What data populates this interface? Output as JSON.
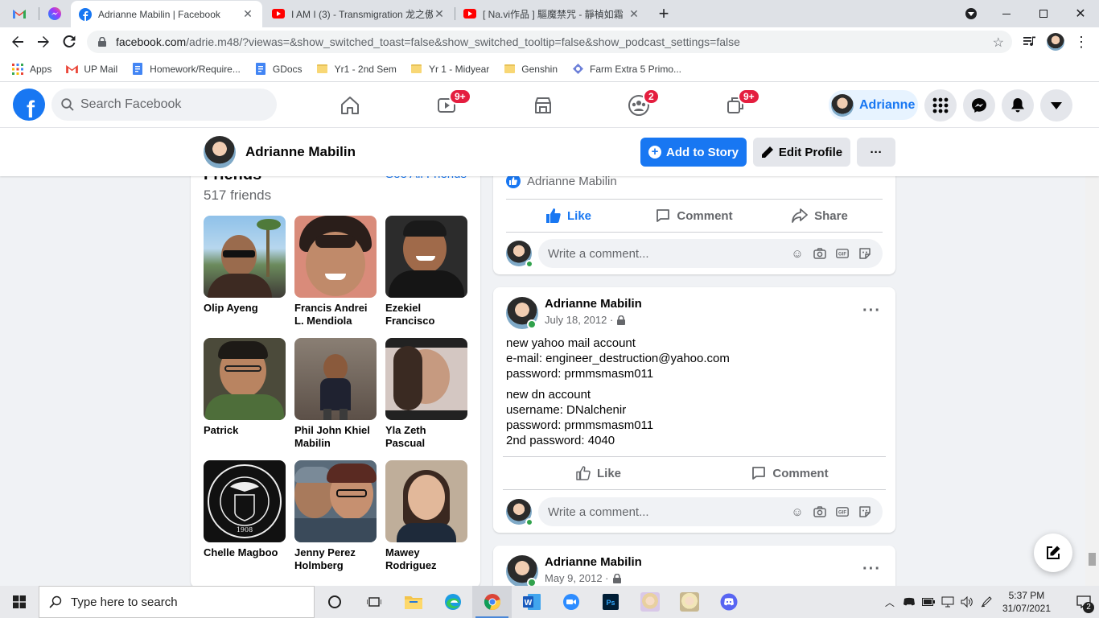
{
  "browser": {
    "tabs": [
      {
        "title": "",
        "icon": "gmail-icon"
      },
      {
        "title": "",
        "icon": "messenger-icon"
      },
      {
        "title": "Adrianne Mabilin | Facebook",
        "icon": "facebook-icon",
        "active": true
      },
      {
        "title": "I AM I (3) - Transmigration 龙之傲",
        "icon": "youtube-icon"
      },
      {
        "title": "[ Na.vi作品 ] 驅魔禁咒 - 靜楨如霜",
        "icon": "youtube-icon"
      }
    ],
    "new_tab": "+",
    "url_host": "facebook.com",
    "url_rest": "/adrie.m48/?viewas=&show_switched_toast=false&show_switched_tooltip=false&show_podcast_settings=false",
    "bookmarks": [
      "Apps",
      "UP Mail",
      "Homework/Require...",
      "GDocs",
      "Yr1 - 2nd Sem",
      "Yr 1 - Midyear",
      "Genshin",
      "Farm Extra 5 Primo..."
    ]
  },
  "fb_nav": {
    "search_placeholder": "Search Facebook",
    "watch_badge": "9+",
    "groups_badge": "2",
    "gaming_badge": "9+",
    "profile_name": "Adrianne"
  },
  "profile_header": {
    "name": "Adrianne Mabilin",
    "add_story": "Add to Story",
    "edit_profile": "Edit Profile",
    "more": "···"
  },
  "friends": {
    "heading": "Friends",
    "see_all": "See All Friends",
    "count": "517 friends",
    "list": [
      {
        "name": "Olip Ayeng"
      },
      {
        "name": "Francis Andrei L. Mendiola"
      },
      {
        "name": "Ezekiel Francisco"
      },
      {
        "name": "Patrick"
      },
      {
        "name": "Phil John Khiel Mabilin"
      },
      {
        "name": "Yla Zeth Pascual"
      },
      {
        "name": "Chelle Magboo"
      },
      {
        "name": "Jenny Perez Holmberg"
      },
      {
        "name": "Mawey Rodriguez"
      }
    ]
  },
  "post_top": {
    "liker": "Adrianne Mabilin",
    "like": "Like",
    "comment": "Comment",
    "share": "Share",
    "comment_placeholder": "Write a comment..."
  },
  "post1": {
    "author": "Adrianne Mabilin",
    "date": "July 18, 2012 ·",
    "lines_a": [
      "new yahoo mail account",
      "e-mail: engineer_destruction@yahoo.com",
      "password: prmmsmasm011"
    ],
    "lines_b": [
      "new dn account",
      "username: DNalchenir",
      "password: prmmsmasm011",
      "2nd password: 4040"
    ],
    "like": "Like",
    "comment": "Comment",
    "comment_placeholder": "Write a comment..."
  },
  "post2": {
    "author": "Adrianne Mabilin",
    "date": "May 9, 2012 ·"
  },
  "taskbar": {
    "search_placeholder": "Type here to search",
    "time": "5:37 PM",
    "date": "31/07/2021",
    "notif_count": "2"
  },
  "colors": {
    "fb_blue": "#1877f2",
    "badge_red": "#e41e3f",
    "online_green": "#31a24c"
  }
}
